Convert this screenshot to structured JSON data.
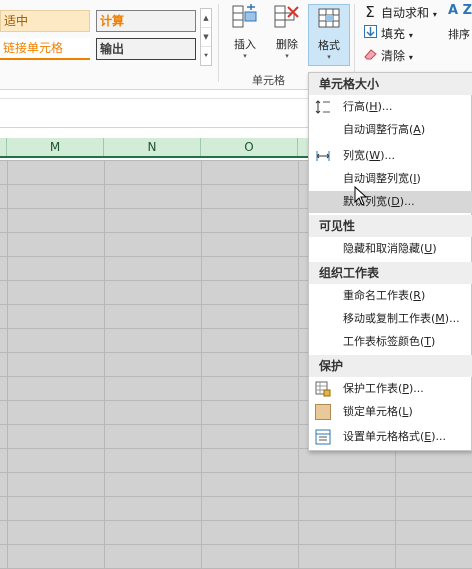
{
  "ribbon": {
    "cell_styles": {
      "good": "适中",
      "calculation": "计算",
      "linked_cell": "链接单元格",
      "output": "输出"
    },
    "cells_group": {
      "insert_label": "插入",
      "delete_label": "删除",
      "format_label": "格式",
      "group_name": "单元格"
    },
    "editing_group": {
      "autosum_label": "自动求和",
      "fill_label": "填充",
      "clear_label": "清除",
      "sort_label": "排序",
      "sort_az": "A Z"
    }
  },
  "columns": [
    "M",
    "N",
    "O"
  ],
  "format_menu": {
    "sections": [
      {
        "title": "单元格大小"
      },
      {
        "title": "可见性"
      },
      {
        "title": "组织工作表"
      },
      {
        "title": "保护"
      }
    ],
    "items": [
      {
        "text": "行高(",
        "key": "H",
        "tail": ")...",
        "icon": "row-height-icon"
      },
      {
        "text": "自动调整行高(",
        "key": "A",
        "tail": ")",
        "icon": ""
      },
      {
        "text": "列宽(",
        "key": "W",
        "tail": ")...",
        "icon": "column-width-icon"
      },
      {
        "text": "自动调整列宽(",
        "key": "I",
        "tail": ")",
        "icon": ""
      },
      {
        "text": "默认列宽(",
        "key": "D",
        "tail": ")...",
        "icon": "",
        "highlighted": true
      },
      {
        "text": "隐藏和取消隐藏(",
        "key": "U",
        "tail": ")",
        "icon": ""
      },
      {
        "text": "重命名工作表(",
        "key": "R",
        "tail": ")",
        "icon": ""
      },
      {
        "text": "移动或复制工作表(",
        "key": "M",
        "tail": ")...",
        "icon": ""
      },
      {
        "text": "工作表标签颜色(",
        "key": "T",
        "tail": ")",
        "icon": ""
      },
      {
        "text": "保护工作表(",
        "key": "P",
        "tail": ")...",
        "icon": "protect-sheet-icon"
      },
      {
        "text": "锁定单元格(",
        "key": "L",
        "tail": ")",
        "icon": "lock-cell-icon"
      },
      {
        "text": "设置单元格格式(",
        "key": "E",
        "tail": ")...",
        "icon": "format-cells-icon"
      }
    ]
  },
  "colors": {
    "accent_green": "#217346",
    "menu_highlight": "#d7d7d7",
    "format_button_active": "#cde6f7"
  }
}
